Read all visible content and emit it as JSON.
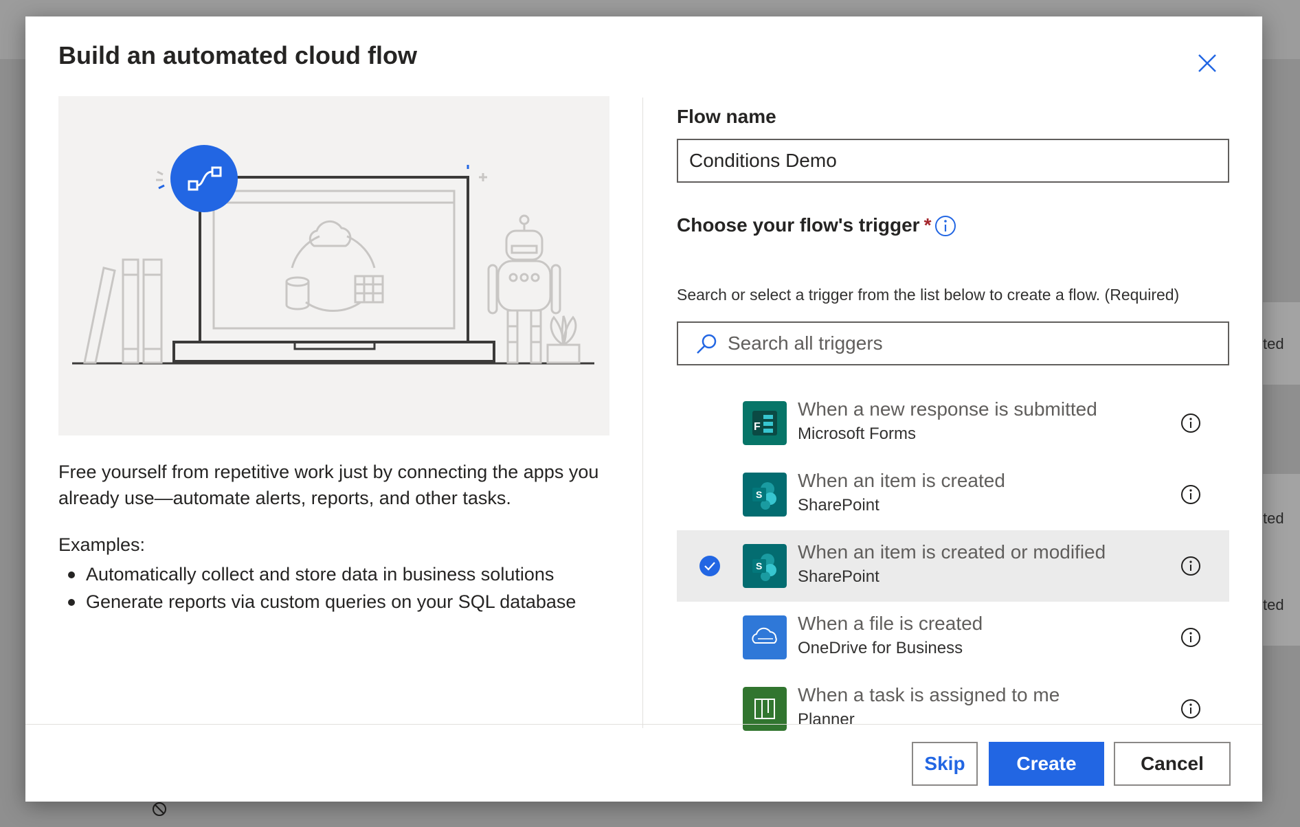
{
  "background": {
    "row_texts": [
      "ted",
      "ted",
      "ted"
    ]
  },
  "dialog": {
    "title": "Build an automated cloud flow",
    "description": "Free yourself from repetitive work just by connecting the apps you already use—automate alerts, reports, and other tasks.",
    "examples_label": "Examples:",
    "examples": [
      "Automatically collect and store data in business solutions",
      "Generate reports via custom queries on your SQL database"
    ],
    "flow_name": {
      "label": "Flow name",
      "value": "Conditions Demo"
    },
    "trigger": {
      "label": "Choose your flow's trigger",
      "required_mark": "*",
      "help_text": "Search or select a trigger from the list below to create a flow. (Required)",
      "search_placeholder": "Search all triggers",
      "items": [
        {
          "title": "When a new response is submitted",
          "connector": "Microsoft Forms",
          "icon": "microsoft-forms-icon",
          "color": "#077568",
          "selected": false
        },
        {
          "title": "When an item is created",
          "connector": "SharePoint",
          "icon": "sharepoint-icon",
          "color": "#036c70",
          "selected": false
        },
        {
          "title": "When an item is created or modified",
          "connector": "SharePoint",
          "icon": "sharepoint-icon",
          "color": "#036c70",
          "selected": true
        },
        {
          "title": "When a file is created",
          "connector": "OneDrive for Business",
          "icon": "onedrive-icon",
          "color": "#2f78d8",
          "selected": false
        },
        {
          "title": "When a task is assigned to me",
          "connector": "Planner",
          "icon": "planner-icon",
          "color": "#31752f",
          "selected": false
        }
      ]
    },
    "buttons": {
      "skip": "Skip",
      "create": "Create",
      "cancel": "Cancel"
    },
    "colors": {
      "accent": "#2266e3",
      "selected_row": "#ebebeb"
    }
  }
}
